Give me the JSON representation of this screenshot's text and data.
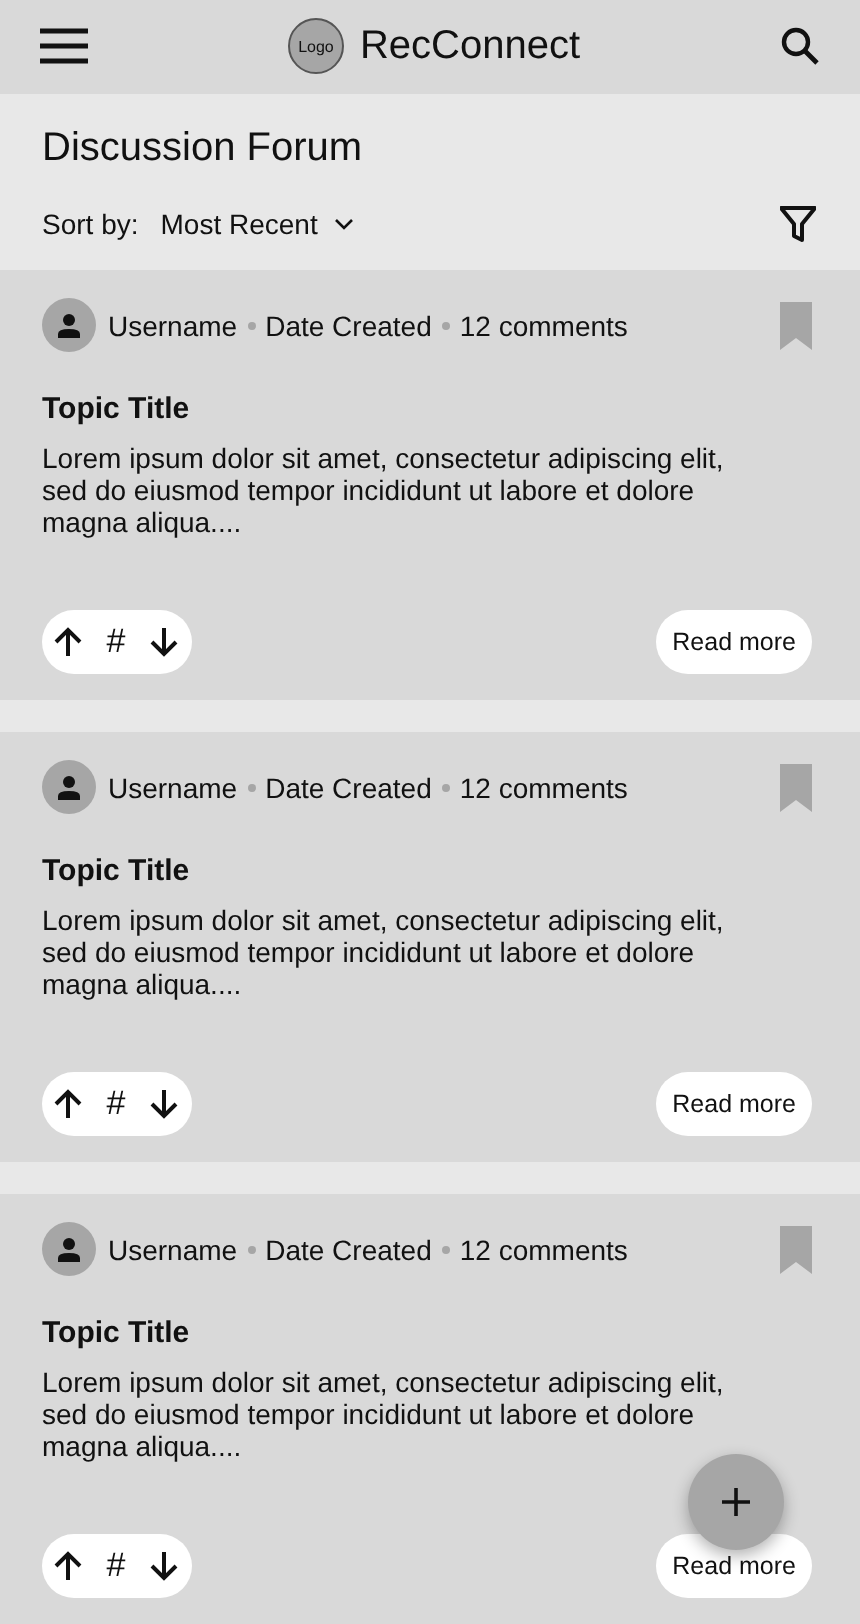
{
  "header": {
    "logo_text": "Logo",
    "app_name": "RecConnect"
  },
  "page_title": "Discussion Forum",
  "sort": {
    "label": "Sort by:",
    "value": "Most Recent"
  },
  "posts": [
    {
      "username": "Username",
      "date": "Date Created",
      "comments": "12 comments",
      "title": "Topic Title",
      "body": "Lorem ipsum dolor sit amet, consectetur adipiscing elit, sed do eiusmod tempor incididunt ut labore et dolore magna aliqua....",
      "score": "#",
      "action": "Read more",
      "bookmarked": false
    },
    {
      "username": "Username",
      "date": "Date Created",
      "comments": "12 comments",
      "title": "Topic Title",
      "body": "Lorem ipsum dolor sit amet, consectetur adipiscing elit, sed do eiusmod tempor incididunt ut labore et dolore magna aliqua....",
      "score": "#",
      "action": "Read more",
      "bookmarked": false
    },
    {
      "username": "Username",
      "date": "Date Created",
      "comments": "12 comments",
      "title": "Topic Title",
      "body": "Lorem ipsum dolor sit amet, consectetur adipiscing elit, sed do eiusmod tempor incididunt ut labore et dolore magna aliqua....",
      "score": "#",
      "action": "Read more",
      "bookmarked": false
    }
  ]
}
